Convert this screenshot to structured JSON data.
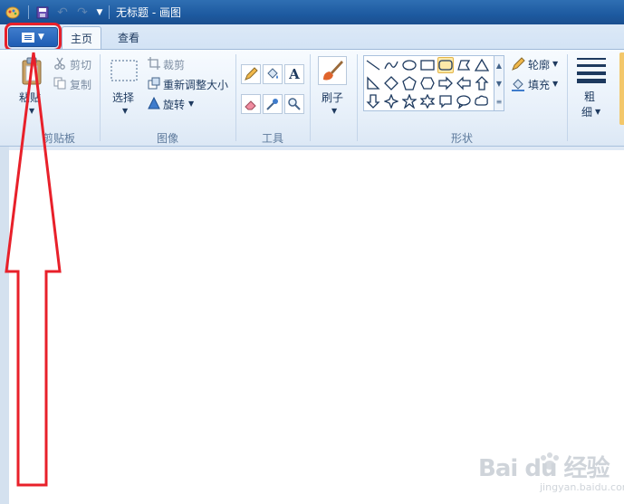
{
  "window": {
    "title": "无标题 - 画图"
  },
  "tabs": [
    {
      "label": "主页"
    },
    {
      "label": "查看"
    }
  ],
  "clipboard": {
    "paste_label": "粘贴",
    "cut_label": "剪切",
    "copy_label": "复制",
    "group_label": "剪贴板"
  },
  "image": {
    "select_label": "选择",
    "crop_label": "裁剪",
    "resize_label": "重新调整大小",
    "rotate_label": "旋转",
    "group_label": "图像"
  },
  "tools": {
    "group_label": "工具",
    "text_tool_glyph": "A"
  },
  "brushes": {
    "label": "刷子"
  },
  "shapes": {
    "outline_label": "轮廓",
    "fill_label": "填充",
    "group_label": "形状"
  },
  "size": {
    "label_top": "粗",
    "label_bottom": "细"
  },
  "watermark": {
    "main": "Bai du 经验",
    "sub": "jingyan.baidu.com"
  },
  "colors": {
    "titlebar": "#1d5aa0",
    "highlight": "#e8202a",
    "menu_button": "#1f5db4"
  }
}
